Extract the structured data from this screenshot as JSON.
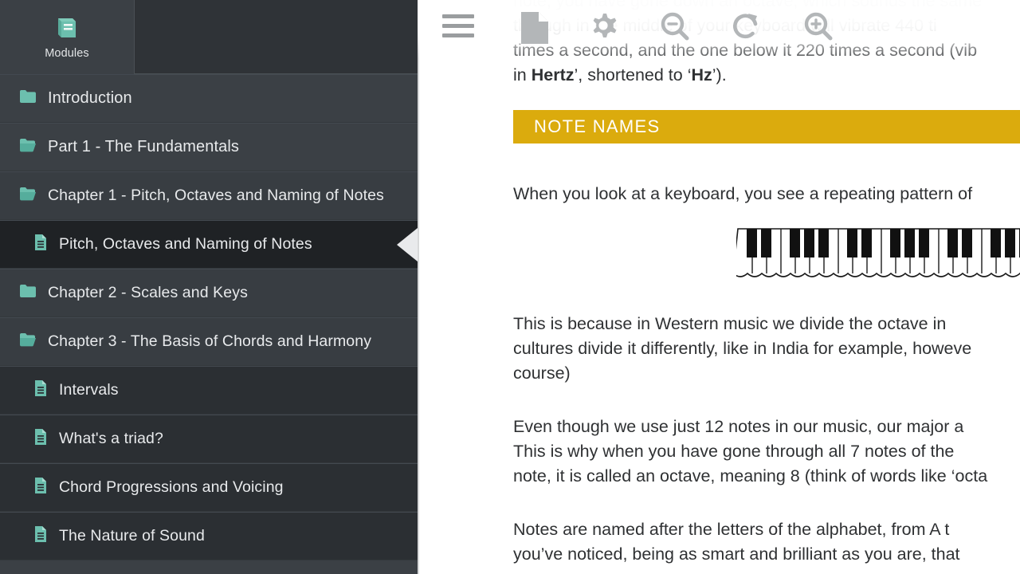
{
  "sidebar": {
    "modules_button": {
      "label": "Modules",
      "icon": "book-icon"
    },
    "items": [
      {
        "label": "Introduction",
        "icon": "folder-closed-icon",
        "level": 0,
        "selected": false
      },
      {
        "label": "Part 1 - The Fundamentals",
        "icon": "folder-open-icon",
        "level": 0,
        "selected": false
      },
      {
        "label": "Chapter 1 - Pitch, Octaves and Naming of Notes",
        "icon": "folder-open-icon",
        "level": 1,
        "selected": false
      },
      {
        "label": "Pitch, Octaves and Naming of Notes",
        "icon": "document-icon",
        "level": 3,
        "selected": true
      },
      {
        "label": "Chapter 2 - Scales and Keys",
        "icon": "folder-closed-icon",
        "level": 1,
        "selected": false
      },
      {
        "label": "Chapter 3 - The Basis of Chords and Harmony",
        "icon": "folder-open-icon",
        "level": 1,
        "selected": false
      },
      {
        "label": "Intervals",
        "icon": "document-icon",
        "level": 2,
        "selected": false
      },
      {
        "label": "What's a triad?",
        "icon": "document-icon",
        "level": 2,
        "selected": false
      },
      {
        "label": "Chord Progressions and Voicing",
        "icon": "document-icon",
        "level": 2,
        "selected": false
      },
      {
        "label": "The Nature of Sound",
        "icon": "document-icon",
        "level": 2,
        "selected": false
      }
    ]
  },
  "toolbar": {
    "menu": {
      "name": "hamburger-menu-icon",
      "label": "Menu"
    },
    "buttons": [
      {
        "name": "document-icon",
        "label": "Document"
      },
      {
        "name": "gear-icon",
        "label": "Settings"
      },
      {
        "name": "zoom-out-icon",
        "label": "Zoom out"
      },
      {
        "name": "refresh-icon",
        "label": "Reload"
      },
      {
        "name": "zoom-in-icon",
        "label": "Zoom in"
      }
    ]
  },
  "content": {
    "scrolled_lines": [
      "note, you have gone down an octave, which sounds the same",
      "through in the middle of your keyboard will vibrate 440 ti",
      "times a second, and the one below it 220 times a second (vib"
    ],
    "hertz_line": {
      "pre": "in ",
      "bold1": "Hertz",
      "mid": "’, shortened to ‘",
      "bold2": "Hz",
      "post": "’)."
    },
    "heading": "NOTE NAMES",
    "para_keyboard": "When you look at a keyboard, you see a repeating pattern of",
    "keyboard_image": "piano-keyboard-diagram",
    "para_western": [
      "This is because in Western music we divide the octave in",
      "cultures divide it differently, like in India for example, howeve",
      "course)"
    ],
    "para_twelve": [
      "Even though we use just 12 notes in our music, our major a",
      "This is why when you have gone through all 7 notes of the",
      "note, it is called an octave, meaning 8 (think of words like ‘octa"
    ],
    "para_letters": [
      "Notes are named after the letters of the alphabet, from A t",
      "you’ve noticed, being as smart and brilliant as you are, that"
    ]
  },
  "colors": {
    "sidebar_bg": "#3b4045",
    "sidebar_selected": "#1f2225",
    "accent_teal": "#6cbfae",
    "heading_yellow": "#dbab0d",
    "text_dark": "#2f3133"
  }
}
